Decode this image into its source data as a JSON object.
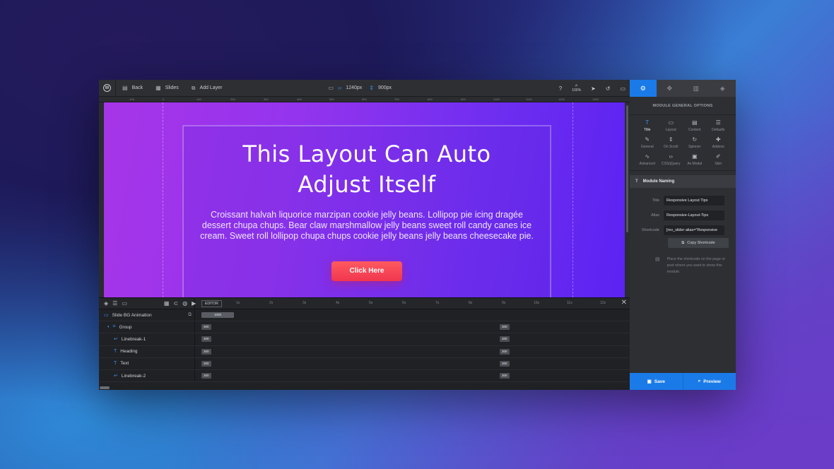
{
  "toolbar": {
    "back_label": "Back",
    "slides_label": "Slides",
    "add_layer_label": "Add Layer",
    "width_value": "1240px",
    "height_value": "900px",
    "zoom_value": "100%"
  },
  "ruler": {
    "ticks": [
      "-100",
      "0",
      "100",
      "200",
      "300",
      "400",
      "500",
      "600",
      "700",
      "800",
      "900",
      "1000",
      "1100",
      "1200",
      "1300"
    ]
  },
  "canvas": {
    "heading_line1": "This Layout Can Auto",
    "heading_line2": "Adjust Itself",
    "body_text": "Croissant halvah liquorice marzipan cookie jelly beans. Lollipop pie icing dragée dessert chupa chups. Bear claw marshmallow jelly beans sweet roll candy canes ice cream. Sweet roll lollipop chupa chups cookie jelly beans jelly beans cheesecake pie.",
    "cta_label": "Click Here"
  },
  "timeline": {
    "editor_label": "EDITOR",
    "scale": [
      "1s",
      "2s",
      "3s",
      "4s",
      "5s",
      "6s",
      "7s",
      "8s",
      "9s",
      "10s",
      "11s",
      "12s"
    ],
    "rows": [
      {
        "label": "Slide BG Animation",
        "chip1": "1000"
      },
      {
        "label": "Group",
        "chip1": "300",
        "chip2": "300"
      },
      {
        "label": "Linebreak-1",
        "chip1": "300",
        "chip2": "300"
      },
      {
        "label": "Heading",
        "chip1": "300",
        "chip2": "300"
      },
      {
        "label": "Text",
        "chip1": "300",
        "chip2": "300"
      },
      {
        "label": "Linebreak-2",
        "chip1": "300",
        "chip2": "300"
      }
    ]
  },
  "panel": {
    "title": "MODULE GENERAL OPTIONS",
    "options": [
      {
        "label": "Title",
        "icon": "T"
      },
      {
        "label": "Layout",
        "icon": "▭"
      },
      {
        "label": "Content",
        "icon": "▤"
      },
      {
        "label": "Defaults",
        "icon": "☰"
      },
      {
        "label": "General",
        "icon": "✎"
      },
      {
        "label": "On Scroll",
        "icon": "⇕"
      },
      {
        "label": "Spinner",
        "icon": "↻"
      },
      {
        "label": "Addons",
        "icon": "✚"
      },
      {
        "label": "Advanced",
        "icon": "∿"
      },
      {
        "label": "CSS/jQuery",
        "icon": "‹›"
      },
      {
        "label": "As Modal",
        "icon": "▣"
      },
      {
        "label": "Skin",
        "icon": "✐"
      }
    ],
    "section_title": "Module Naming",
    "fields": {
      "title_label": "Title",
      "title_value": "Responsive Layout Tips",
      "alias_label": "Alias",
      "alias_value": "Responsive-Layout-Tips",
      "shortcode_label": "Shortcode",
      "shortcode_value": "[rev_slider alias=\"Responsive"
    },
    "copy_label": "Copy Shortcode",
    "hint": "Place the shortcode on the page or post where you want to show this module.",
    "save_label": "Save",
    "preview_label": "Preview"
  },
  "colors": {
    "accent": "#1a7be8",
    "cta": "#f0364f",
    "canvas_start": "#a735e8",
    "canvas_end": "#5b22f2"
  }
}
